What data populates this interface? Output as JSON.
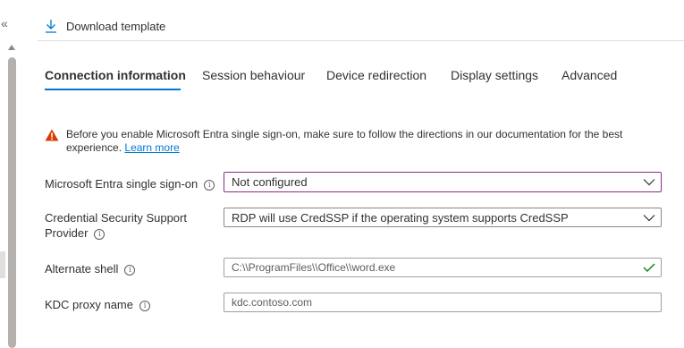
{
  "nav": {
    "collapse_glyph": "«"
  },
  "toolbar": {
    "download_label": "Download template",
    "download_icon": "download-arrow-icon"
  },
  "tabs": [
    {
      "label": "Connection information",
      "active": true
    },
    {
      "label": "Session behaviour",
      "active": false
    },
    {
      "label": "Device redirection",
      "active": false
    },
    {
      "label": "Display settings",
      "active": false
    },
    {
      "label": "Advanced",
      "active": false
    }
  ],
  "warning": {
    "text": "Before you enable Microsoft Entra single sign-on, make sure to follow the directions in our documentation for the best experience.",
    "link_label": "Learn more",
    "icon": "warning-triangle-icon"
  },
  "fields": {
    "sso": {
      "label": "Microsoft Entra single sign-on",
      "value": "Not configured"
    },
    "credssp": {
      "label": "Credential Security Support Provider",
      "value": "RDP will use CredSSP if the operating system supports CredSSP"
    },
    "shell": {
      "label": "Alternate shell",
      "value": "C:\\\\ProgramFiles\\\\Office\\\\word.exe"
    },
    "kdc": {
      "label": "KDC proxy name",
      "value": "kdc.contoso.com"
    }
  },
  "colors": {
    "accent": "#0078d4",
    "warning": "#d83b01",
    "focus_border": "#8a2b88",
    "valid": "#107c10"
  }
}
